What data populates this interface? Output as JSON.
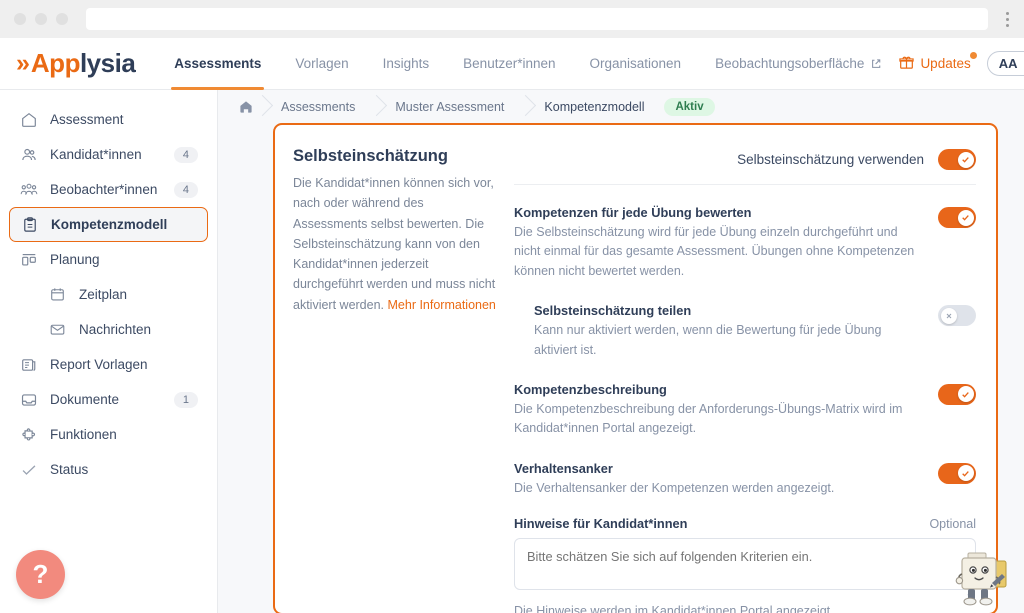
{
  "browser": {
    "menu_icon": "kebab-menu-icon",
    "address_value": ""
  },
  "brand": {
    "prefix": "App",
    "suffix": "lysia",
    "chevron": "»",
    "accent": "#EA6A14",
    "dark": "#2f3e58"
  },
  "topnav": {
    "items": [
      {
        "label": "Assessments",
        "active": true,
        "external": false
      },
      {
        "label": "Vorlagen",
        "active": false,
        "external": false
      },
      {
        "label": "Insights",
        "active": false,
        "external": false
      },
      {
        "label": "Benutzer*innen",
        "active": false,
        "external": false
      },
      {
        "label": "Organisationen",
        "active": false,
        "external": false
      },
      {
        "label": "Beobachtungsoberfläche",
        "active": false,
        "external": true
      }
    ],
    "updates_label": "Updates",
    "updates_icon": "gift-icon",
    "avatar_initials": "AA"
  },
  "sidebar": {
    "items": [
      {
        "label": "Assessment",
        "icon": "home-icon",
        "count": "",
        "selected": false,
        "sub": false
      },
      {
        "label": "Kandidat*innen",
        "icon": "users-icon",
        "count": "4",
        "selected": false,
        "sub": false
      },
      {
        "label": "Beobachter*innen",
        "icon": "group-icon",
        "count": "4",
        "selected": false,
        "sub": false
      },
      {
        "label": "Kompetenzmodell",
        "icon": "clipboard-icon",
        "count": "",
        "selected": true,
        "sub": false
      },
      {
        "label": "Planung",
        "icon": "layout-icon",
        "count": "",
        "selected": false,
        "sub": false
      },
      {
        "label": "Zeitplan",
        "icon": "calendar-icon",
        "count": "",
        "selected": false,
        "sub": true
      },
      {
        "label": "Nachrichten",
        "icon": "mail-icon",
        "count": "",
        "selected": false,
        "sub": true
      },
      {
        "label": "Report Vorlagen",
        "icon": "report-icon",
        "count": "",
        "selected": false,
        "sub": false
      },
      {
        "label": "Dokumente",
        "icon": "inbox-icon",
        "count": "1",
        "selected": false,
        "sub": false
      },
      {
        "label": "Funktionen",
        "icon": "puzzle-icon",
        "count": "",
        "selected": false,
        "sub": false
      },
      {
        "label": "Status",
        "icon": "check-icon",
        "count": "",
        "selected": false,
        "sub": false
      }
    ],
    "help_label": "?"
  },
  "breadcrumb": {
    "home_icon": "home-icon",
    "crumbs": [
      "Assessments",
      "Muster Assessment",
      "Kompetenzmodell"
    ],
    "status_badge": "Aktiv",
    "status_bg": "#DEF7E4",
    "status_fg": "#2E7D4F"
  },
  "panel": {
    "heading": "Selbsteinschätzung",
    "description": "Die Kandidat*innen können sich vor, nach oder während des Assessments selbst bewerten. Die Selbsteinschätzung kann von den Kandidat*innen jederzeit durchgeführt werden und muss nicht aktiviert werden.",
    "link": "Mehr Informationen",
    "main_toggle": {
      "label": "Selbsteinschätzung verwenden",
      "state": "on"
    },
    "settings": [
      {
        "title": "Kompetenzen für jede Übung bewerten",
        "desc": "Die Selbsteinschätzung wird für jede Übung einzeln durchgeführt und nicht einmal für das gesamte Assessment. Übungen ohne Kompetenzen können nicht bewertet werden.",
        "state": "on",
        "indent": false
      },
      {
        "title": "Selbsteinschätzung teilen",
        "desc": "Kann nur aktiviert werden, wenn die Bewertung für jede Übung aktiviert ist.",
        "state": "off",
        "indent": true
      },
      {
        "title": "Kompetenzbeschreibung",
        "desc": "Die Kompetenzbeschreibung der Anforderungs-Übungs-Matrix wird im Kandidat*innen Portal angezeigt.",
        "state": "on",
        "indent": false
      },
      {
        "title": "Verhaltensanker",
        "desc": "Die Verhaltensanker der Kompetenzen werden angezeigt.",
        "state": "on",
        "indent": false
      }
    ],
    "notes_field": {
      "label": "Hinweise für Kandidat*innen",
      "optional": "Optional",
      "placeholder": "Bitte schätzen Sie sich auf folgenden Kriterien ein.",
      "value": "",
      "helper": "Die Hinweise werden im Kandidat*innen Portal angezeigt."
    }
  },
  "colors": {
    "accent": "#EA6A14",
    "toggle_on": "#E8661A",
    "toggle_off": "#dfe3ea",
    "help_fab": "#F28A7E"
  }
}
